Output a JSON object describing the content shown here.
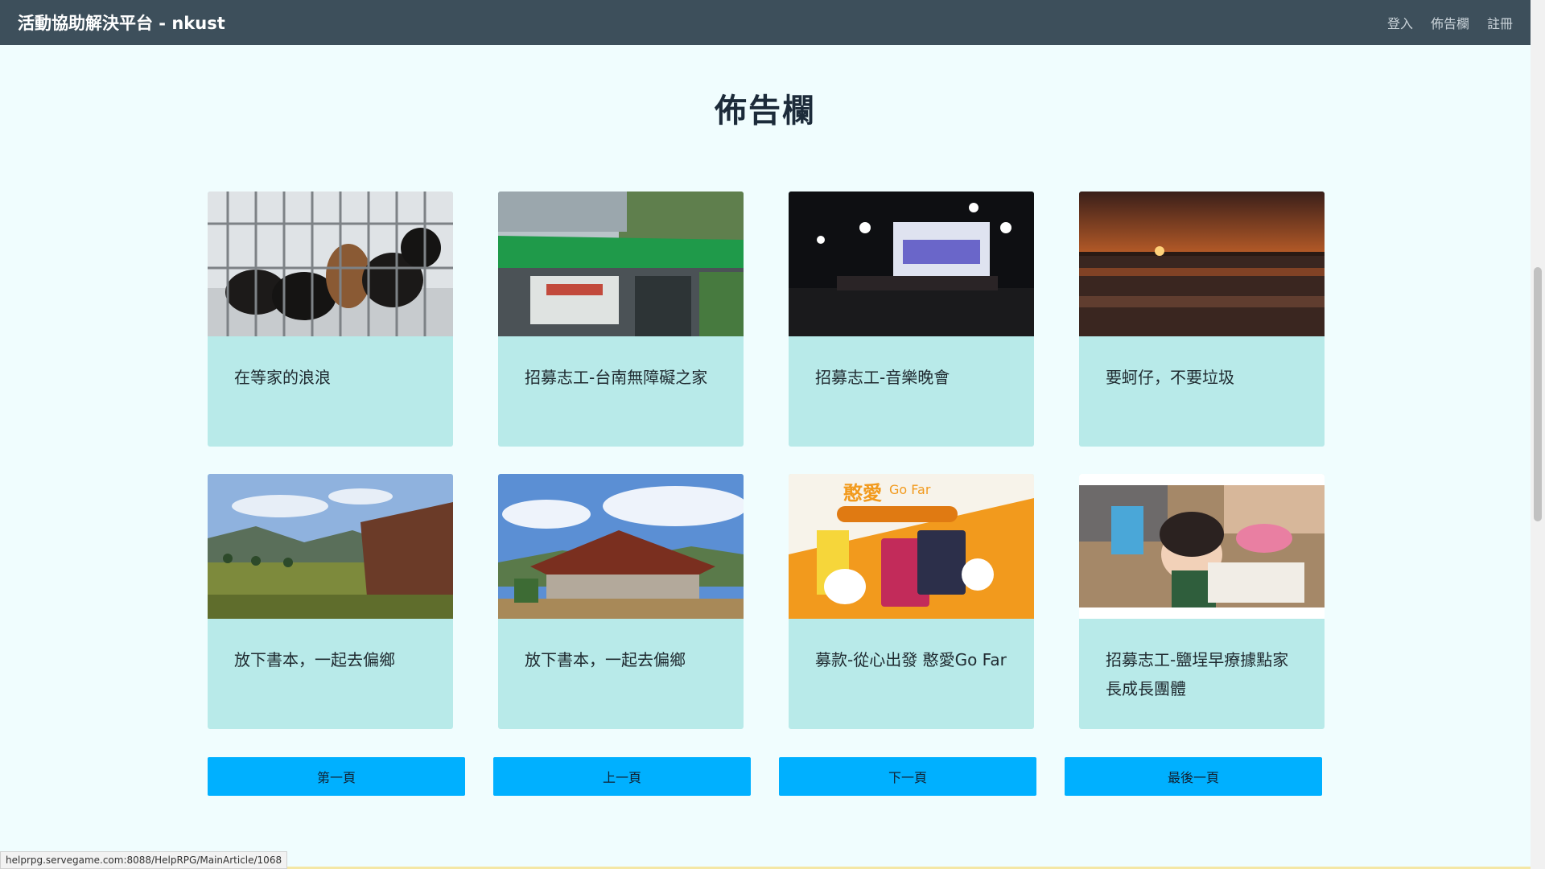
{
  "navbar": {
    "brand": "活動協助解決平台 - nkust",
    "links": [
      "登入",
      "佈告欄",
      "註冊"
    ]
  },
  "page": {
    "title": "佈告欄"
  },
  "cards": [
    {
      "title": "在等家的浪浪",
      "image": "puppies-in-cage-photo"
    },
    {
      "title": "招募志工-台南無障礙之家",
      "image": "tainan-government-home-entrance-photo"
    },
    {
      "title": "招募志工-音樂晚會",
      "image": "night-concert-stage-photo"
    },
    {
      "title": "要蚵仔，不要垃圾",
      "image": "sunset-over-sea-photo"
    },
    {
      "title": "放下書本，一起去偏鄉",
      "image": "mountain-lawn-building-photo"
    },
    {
      "title": "放下書本，一起去偏鄉",
      "image": "wooden-pavilion-photo"
    },
    {
      "title": "募款-從心出發 憨愛Go Far",
      "image": "go-far-cups-poster"
    },
    {
      "title": "招募志工-鹽埕早療據點家長成長團體",
      "image": "children-classroom-photo"
    }
  ],
  "pager": {
    "first": "第一頁",
    "prev": "上一頁",
    "next": "下一頁",
    "last": "最後一頁"
  },
  "status_bar": {
    "url": "helprpg.servegame.com:8088/HelpRPG/MainArticle/1068"
  },
  "colors": {
    "navbar": "#3d4f5b",
    "page_bg": "#f0fdfe",
    "card_bg": "#b8eae9",
    "button": "#00b0ff"
  },
  "poster_text": {
    "headline": "憨愛",
    "subhead": "Go Far"
  }
}
